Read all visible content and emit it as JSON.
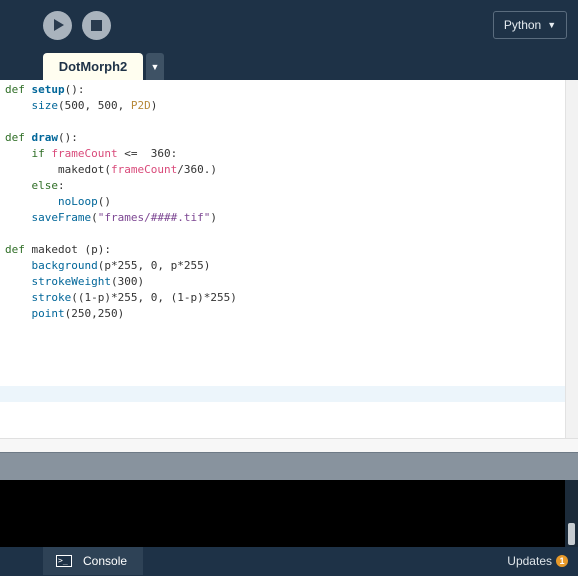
{
  "toolbar": {
    "run_icon": "play-icon",
    "stop_icon": "stop-icon",
    "mode": "Python",
    "mode_arrow": "▼"
  },
  "tabs": {
    "active": "DotMorph2",
    "menu_arrow": "▼"
  },
  "code": {
    "l1_kw": "def",
    "l1_fn": "setup",
    "l1_rest": "():",
    "l2_fn": "size",
    "l2_args": "(500, 500, ",
    "l2_const": "P2D",
    "l2_close": ")",
    "l4_kw": "def",
    "l4_fn": "draw",
    "l4_rest": "():",
    "l5_kw": "if",
    "l5_var": "frameCount",
    "l5_rest": " <=  360:",
    "l6_text": "makedot(",
    "l6_var": "frameCount",
    "l6_rest": "/360.)",
    "l7_kw": "else",
    "l7_rest": ":",
    "l8_fn": "noLoop",
    "l8_rest": "()",
    "l9_fn": "saveFrame",
    "l9_open": "(",
    "l9_str": "\"frames/####.tif\"",
    "l9_close": ")",
    "l11_kw": "def",
    "l11_rest": " makedot (p):",
    "l12_fn": "background",
    "l12_rest": "(p*255, 0, p*255)",
    "l13_fn": "strokeWeight",
    "l13_rest": "(300)",
    "l14_fn": "stroke",
    "l14_rest": "((1-p)*255, 0, (1-p)*255)",
    "l15_fn": "point",
    "l15_rest": "(250,250)"
  },
  "footer": {
    "console_label": "Console",
    "console_icon": "terminal-icon",
    "console_icon_glyph": ">_",
    "updates_label": "Updates",
    "updates_count": "1"
  },
  "colors": {
    "toolbar_bg": "#1e3247",
    "editor_bg": "#ffffff",
    "keyword": "#2f6e26",
    "function": "#006699",
    "string": "#7d4793",
    "variable": "#d94a7a",
    "constant": "#b7893a",
    "badge": "#e89a2a"
  }
}
